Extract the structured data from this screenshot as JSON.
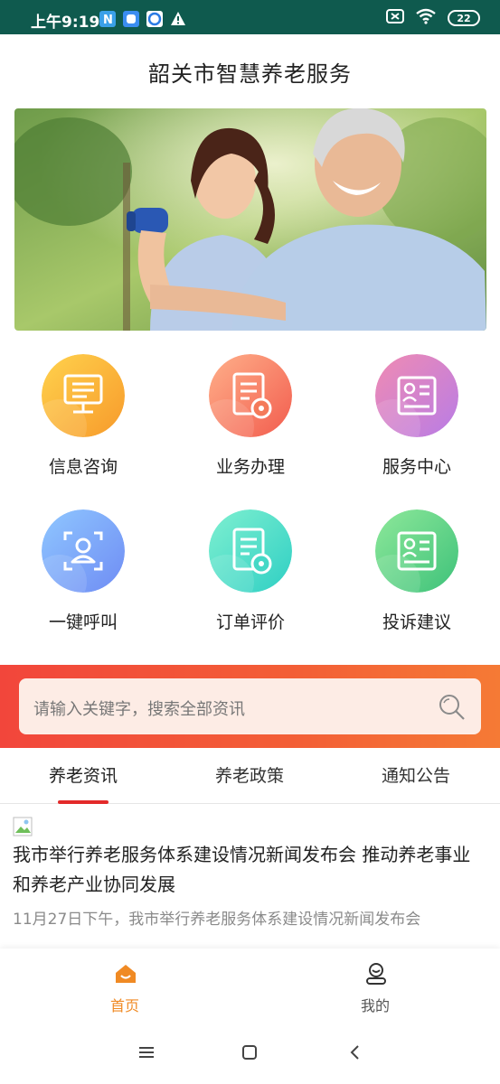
{
  "status_bar": {
    "time": "上午9:19",
    "battery": "22"
  },
  "header": {
    "title": "韶关市智慧养老服务"
  },
  "banner": {
    "description_icon": "elderly-care-banner"
  },
  "services": [
    {
      "label": "信息咨询",
      "icon": "monitor-list-icon",
      "colors": [
        "#ffd24d",
        "#f79a2b"
      ]
    },
    {
      "label": "业务办理",
      "icon": "document-badge-icon",
      "colors": [
        "#ffb08a",
        "#f25c4e"
      ]
    },
    {
      "label": "服务中心",
      "icon": "id-card-icon",
      "colors": [
        "#f08bb2",
        "#b87ce6"
      ]
    },
    {
      "label": "一键呼叫",
      "icon": "user-scan-icon",
      "colors": [
        "#8fc7ff",
        "#6f8cf4"
      ]
    },
    {
      "label": "订单评价",
      "icon": "document-badge-icon",
      "colors": [
        "#7ff0d0",
        "#2fcfc4"
      ]
    },
    {
      "label": "投诉建议",
      "icon": "id-card-icon",
      "colors": [
        "#8ee89a",
        "#3ec27a"
      ]
    }
  ],
  "search": {
    "placeholder": "请输入关键字，搜索全部资讯"
  },
  "tabs": [
    {
      "label": "养老资讯",
      "active": true
    },
    {
      "label": "养老政策",
      "active": false
    },
    {
      "label": "通知公告",
      "active": false
    }
  ],
  "news": {
    "headline": "我市举行养老服务体系建设情况新闻发布会 推动养老事业和养老产业协同发展",
    "summary": "11月27日下午，我市举行养老服务体系建设情况新闻发布会"
  },
  "bottom_nav": [
    {
      "label": "首页",
      "active": true
    },
    {
      "label": "我的",
      "active": false
    }
  ],
  "colors": {
    "status_bar": "#0f5a4e",
    "accent": "#e32a2a",
    "nav_active": "#f08a24"
  }
}
